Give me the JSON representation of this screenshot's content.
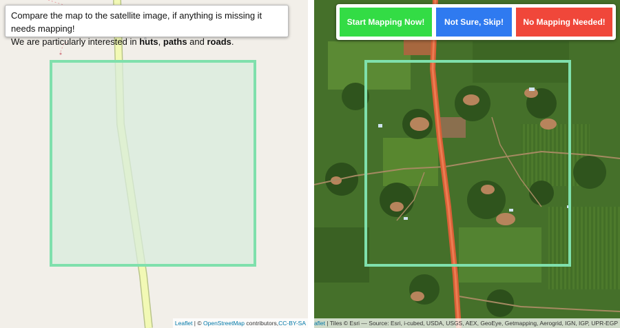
{
  "instructions": {
    "line1": "Compare the map to the satellite image, if anything is missing it needs mapping!",
    "line2_prefix": "We are particularly interested in ",
    "term_huts": "huts",
    "sep1": ", ",
    "term_paths": "paths",
    "sep2": " and ",
    "term_roads": "roads",
    "line2_suffix": "."
  },
  "buttons": {
    "start_label": "Start Mapping Now!",
    "skip_label": "Not Sure, Skip!",
    "none_label": "No Mapping Needed!"
  },
  "osm_attribution": {
    "leaflet": "Leaflet",
    "separator": " | © ",
    "osm_link": "OpenStreetMap",
    "contributors": " contributors,",
    "license": "CC-BY-SA"
  },
  "sat_attribution": {
    "leaflet": "Leaflet",
    "text": " | Tiles © Esri — Source: Esri, i-cubed, USDA, USGS, AEX, GeoEye, Getmapping, Aerogrid, IGN, IGP, UPR-EGP"
  },
  "colors": {
    "selection_stroke": "#7fe0ac",
    "selection_fill": "#d8ecdc",
    "road_osm": "#f2f9b5",
    "road_sat": "#e0653e",
    "btn_start": "#33dc45",
    "btn_skip": "#2f7af0",
    "btn_none": "#f0473a"
  }
}
